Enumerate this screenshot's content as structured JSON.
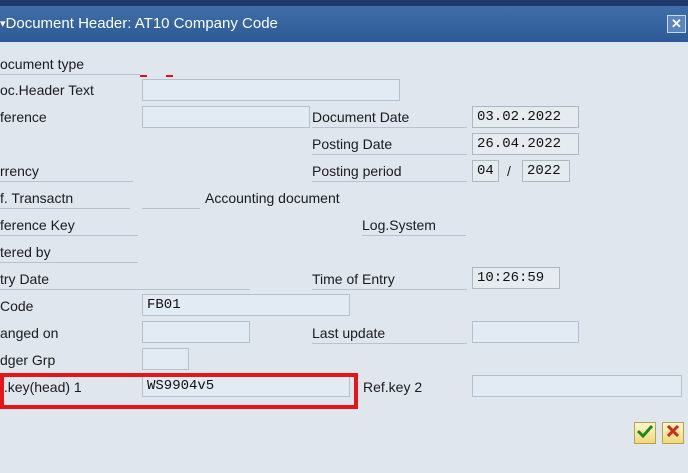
{
  "window": {
    "title": "Document Header: AT10 Company Code",
    "close_glyph": "✕"
  },
  "labels": {
    "document_type": "ocument type",
    "doc_header_text": "oc.Header Text",
    "reference": "ference",
    "currency": "rrency",
    "ref_transaction": "f. Transactn",
    "reference_key": "ference Key",
    "entered_by": "tered by",
    "entry_date": "try Date",
    "company_code": "Code",
    "changed_on": "anged on",
    "ledger_group": "dger Grp",
    "ref_key_head_1": "f.key(head) 1",
    "document_date": "Document Date",
    "posting_date": "Posting Date",
    "posting_period": "Posting period",
    "accounting_document": "Accounting document",
    "log_system": "Log.System",
    "time_of_entry": "Time of Entry",
    "last_update": "Last update",
    "ref_key_2": "Ref.key 2"
  },
  "values": {
    "doc_header_text": "",
    "reference": "",
    "ref_transaction": "",
    "company_code": "FB01",
    "changed_on": "",
    "ledger_group": "",
    "ref_key_head_1": "WS9904v5",
    "document_date": "03.02.2022",
    "posting_date": "26.04.2022",
    "posting_period_month": "04",
    "posting_period_year": "2022",
    "time_of_entry": "10:26:59",
    "last_update": "",
    "ref_key_2": ""
  },
  "separators": {
    "period_slash": "/"
  },
  "buttons": {
    "confirm_icon": "checkmark-icon",
    "cancel_icon": "cross-icon"
  },
  "colors": {
    "title_bar": "#2d5a95",
    "highlight_box": "#e51616",
    "background": "#dfe6ee"
  }
}
